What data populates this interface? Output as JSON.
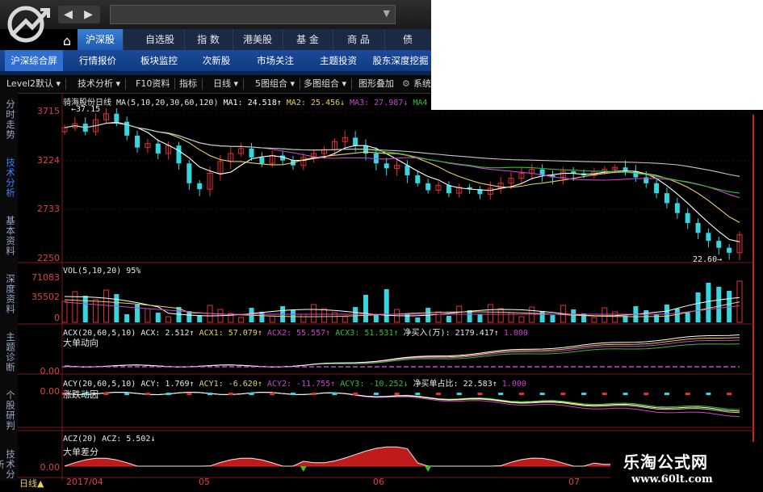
{
  "nav": {
    "back": "◀",
    "forward": "▶",
    "home": "⌂"
  },
  "main_tabs": [
    {
      "label": "沪深股",
      "active": true
    },
    {
      "label": "自选股"
    },
    {
      "label": "指 数"
    },
    {
      "label": "港美股"
    },
    {
      "label": "基 金"
    },
    {
      "label": "商 品"
    },
    {
      "label": "债"
    }
  ],
  "sub_tabs": [
    {
      "label": "沪深综合屏",
      "active": true
    },
    {
      "label": "行情报价"
    },
    {
      "label": "板块监控"
    },
    {
      "label": "次新股"
    },
    {
      "label": "市场关注"
    },
    {
      "label": "主题投资"
    },
    {
      "label": "股东深度挖掘"
    }
  ],
  "toolbar": [
    "Level2默认 ▾",
    "技术分析 ▾",
    "F10资料",
    "指标",
    "日线 ▾",
    "5图组合 ▾",
    "多图组合 ▾",
    "图形叠加",
    "系统"
  ],
  "vtabs": [
    "分时走势",
    "技术分析",
    "基本资料",
    "深度资料",
    "主题诊断",
    "个股研判",
    "技术分析"
  ],
  "price_panel": {
    "title": "骑海股份日线",
    "ma_label": "MA(5,10,20,30,60,120)",
    "ma1": "MA1: 24.518↑",
    "ma2": "MA2: 25.456↓",
    "ma3": "MA3: 27.987↓",
    "ma4": "MA4",
    "high_marker": "←37.15",
    "low_marker": "22.60→",
    "y_ticks": [
      "3715",
      "3224",
      "2733",
      "2250"
    ]
  },
  "vol_panel": {
    "title": "VOL(5,10,20) 95%",
    "y_ticks": [
      "71083",
      "35502",
      "0"
    ]
  },
  "acx_panel": {
    "title": "ACX(20,60,5,10) ACX: 2.512↑",
    "acx1": "ACX1: 57.079↑",
    "acx2": "ACX2: 55.557↑",
    "acx3": "ACX3: 51.531↑",
    "net": "净买入(万): 2179.417↑",
    "one": "1.000",
    "sub": "大单动向",
    "y_ticks": [
      "0.00",
      "0.00"
    ]
  },
  "acy_panel": {
    "title": "ACY(20,60,5,10) ACY: 1.769↑",
    "acy1": "ACY1: -6.620↑",
    "acy2": "ACY2: -11.755↑",
    "acy3": "ACY3: -10.252↓",
    "net": "净买单占比: 22.583↑",
    "one": "1.000",
    "sub": "涨跌动因",
    "y_ticks": [
      "0.00",
      "0.00"
    ]
  },
  "acz_panel": {
    "title": "ACZ(20) ACZ: 5.502↓",
    "sub": "大单差分",
    "y_ticks": [
      "0.00"
    ]
  },
  "x_axis": {
    "bottom_label": "日线▲",
    "ticks": [
      "2017/04",
      "05",
      "06",
      "07"
    ]
  },
  "watermark": {
    "line1": "乐淘公式网",
    "line2": "www.60lt.com"
  },
  "colors": {
    "up": "#e53030",
    "down": "#35d6e0",
    "ma5": "#ffffff",
    "ma10": "#e8d25a",
    "ma20": "#d040d0",
    "ma30": "#30c030",
    "ma60": "#c8c8c8"
  },
  "chart_data": {
    "type": "candlestick",
    "price_range": [
      2250,
      3715
    ],
    "candles_close": [
      3560,
      3600,
      3520,
      3640,
      3700,
      3620,
      3480,
      3360,
      3400,
      3300,
      3380,
      3200,
      3000,
      2940,
      3100,
      3220,
      3300,
      3350,
      3260,
      3200,
      3280,
      3230,
      3180,
      3260,
      3300,
      3340,
      3420,
      3460,
      3380,
      3300,
      3200,
      3150,
      3180,
      3080,
      3000,
      2930,
      2980,
      2900,
      2960,
      2940,
      2890,
      2950,
      3000,
      3050,
      3100,
      3140,
      3080,
      3060,
      3120,
      3100,
      3080,
      3120,
      3140,
      3160,
      3120,
      3060,
      3000,
      2900,
      2800,
      2700,
      2600,
      2500,
      2420,
      2350,
      2300,
      2480
    ]
  }
}
